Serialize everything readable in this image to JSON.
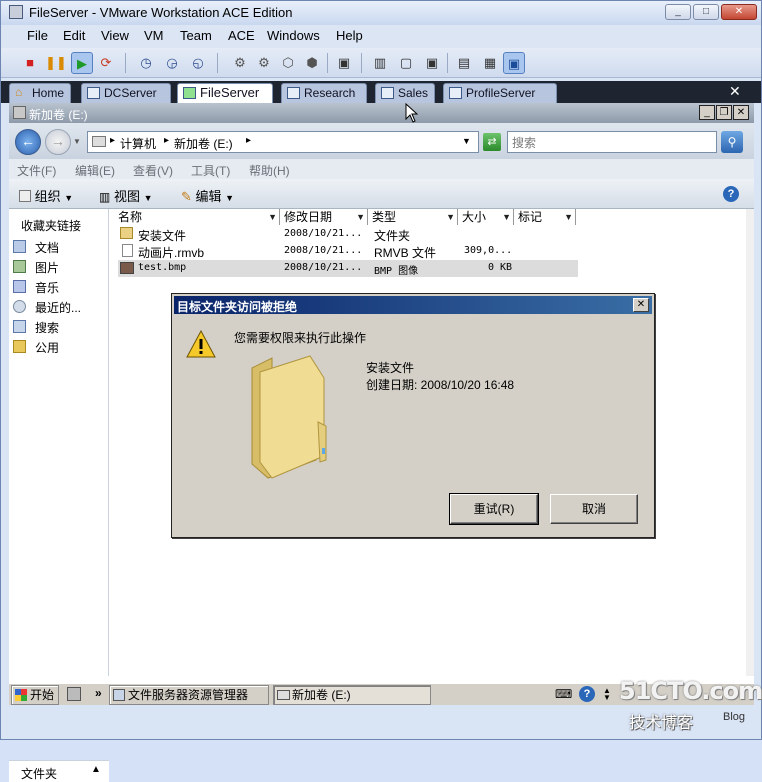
{
  "vmware": {
    "title": "FileServer - VMware Workstation ACE Edition",
    "menu": [
      "File",
      "Edit",
      "View",
      "VM",
      "Team",
      "ACE",
      "Windows",
      "Help"
    ],
    "tabs": [
      {
        "label": "Home",
        "active": false
      },
      {
        "label": "DCServer",
        "active": false
      },
      {
        "label": "FileServer",
        "active": true
      },
      {
        "label": "Research",
        "active": false
      },
      {
        "label": "Sales",
        "active": false
      },
      {
        "label": "ProfileServer",
        "active": false
      }
    ]
  },
  "explorer": {
    "title": "新加卷 (E:)",
    "address": {
      "root": "计算机",
      "drive": "新加卷 (E:)"
    },
    "search_placeholder": "搜索",
    "menu": [
      "文件(F)",
      "编辑(E)",
      "查看(V)",
      "工具(T)",
      "帮助(H)"
    ],
    "commands": {
      "organize": "组织",
      "views": "视图",
      "edit": "编辑"
    },
    "sidebar": {
      "heading": "收藏夹链接",
      "items": [
        "文档",
        "图片",
        "音乐",
        "最近的...",
        "搜索",
        "公用"
      ],
      "folders_label": "文件夹"
    },
    "columns": [
      "名称",
      "修改日期",
      "类型",
      "大小",
      "标记"
    ],
    "files": [
      {
        "name": "安装文件",
        "date": "2008/10/21...",
        "type": "文件夹",
        "size": ""
      },
      {
        "name": "动画片.rmvb",
        "date": "2008/10/21...",
        "type": "RMVB 文件",
        "size": "309,0..."
      },
      {
        "name": "test.bmp",
        "date": "2008/10/21...",
        "type": "BMP 图像",
        "size": "0 KB"
      }
    ]
  },
  "dialog": {
    "title": "目标文件夹访问被拒绝",
    "message": "您需要权限来执行此操作",
    "item_name": "安装文件",
    "item_date": "创建日期: 2008/10/20 16:48",
    "retry_label": "重试(R)",
    "cancel_label": "取消"
  },
  "taskbar": {
    "start": "开始",
    "tasks": [
      "文件服务器资源管理器",
      "新加卷 (E:)"
    ]
  },
  "watermark": {
    "line1": "51CTO.com",
    "line2": "技术博客",
    "line3": "Blog"
  },
  "colors": {
    "vmware_chrome": "#d9e4f5",
    "dialog_title": "#0a246a",
    "tab_bar": "#1e2430"
  }
}
